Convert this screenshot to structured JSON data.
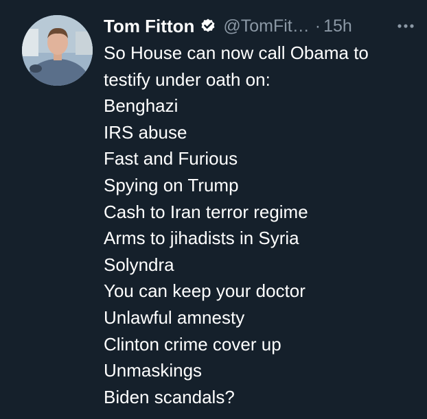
{
  "tweet": {
    "author_name": "Tom Fitton",
    "handle": "@TomFit…",
    "separator": "·",
    "time": "15h",
    "verified": true,
    "lines": [
      "So House can now call Obama to",
      "testify under oath on:",
      "Benghazi",
      "IRS abuse",
      "Fast and Furious",
      "Spying on Trump",
      "Cash to Iran terror regime",
      "Arms to jihadists in Syria",
      "Solyndra",
      "You can keep your doctor",
      "Unlawful amnesty",
      "Clinton crime cover up",
      "Unmaskings",
      "Biden scandals?"
    ]
  },
  "icons": {
    "verified": "verified-badge-icon",
    "more": "more-options-icon"
  },
  "colors": {
    "background": "#15202b",
    "text": "#ffffff",
    "muted": "#8b98a5"
  }
}
